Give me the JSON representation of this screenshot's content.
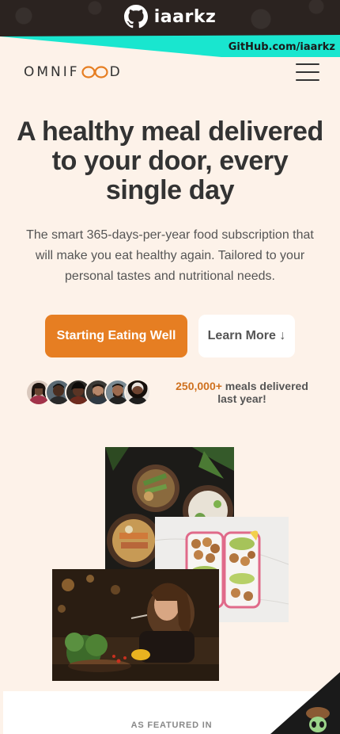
{
  "banner": {
    "github_name": "iaarkz",
    "ribbon_text": "GitHub.com/iaarkz",
    "ribbon_color": "#19e6cf"
  },
  "header": {
    "logo_left": "OMNIF",
    "logo_right": "D"
  },
  "hero": {
    "title": "A healthy meal delivered to your door, every single day",
    "text": "The smart 365-days-per-year food subscription that will make you eat healthy again. Tailored to your personal tastes and nutritional needs.",
    "primary_button": "Starting Eating Well",
    "secondary_button": "Learn More ↓"
  },
  "delivered": {
    "count": "250,000+",
    "text_1": " meals delivered",
    "text_2": "last year!"
  },
  "featured": {
    "label": "AS FEATURED IN"
  },
  "colors": {
    "primary": "#e67e22",
    "background": "#fdf2e9",
    "text": "#333333"
  }
}
